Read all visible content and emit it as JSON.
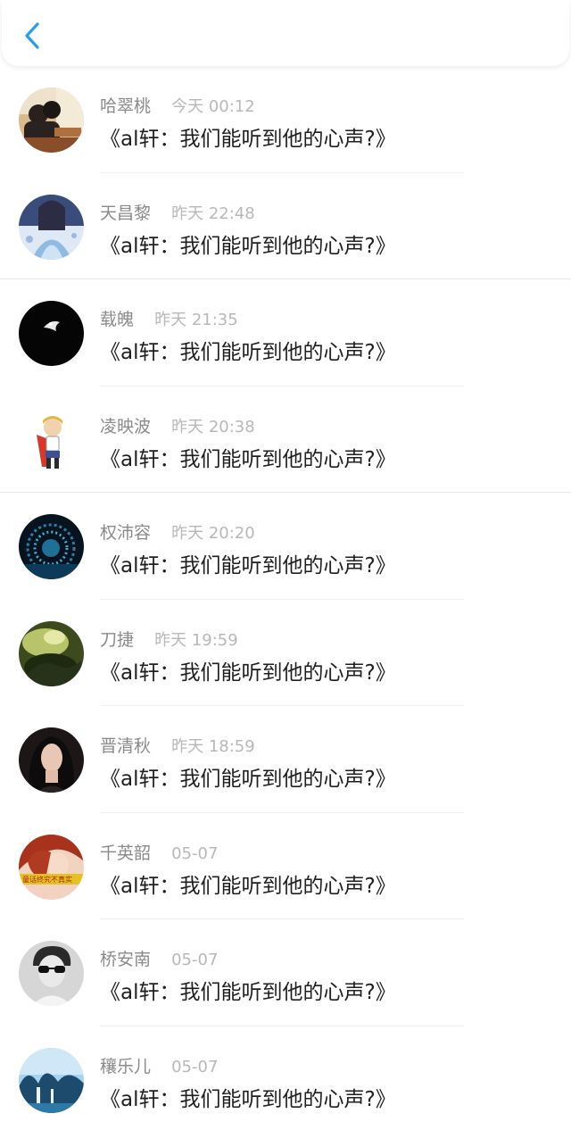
{
  "header": {
    "back_icon": "chevron-left-icon",
    "accent": "#2f9be3"
  },
  "messages": [
    {
      "name": "哈翠桃",
      "time": "今天 00:12",
      "text": "《al轩：我们能听到他的心声?》"
    },
    {
      "name": "天昌黎",
      "time": "昨天 22:48",
      "text": "《al轩：我们能听到他的心声?》"
    },
    {
      "name": "载魄",
      "time": "昨天 21:35",
      "text": "《al轩：我们能听到他的心声?》"
    },
    {
      "name": "凌映波",
      "time": "昨天 20:38",
      "text": "《al轩：我们能听到他的心声?》"
    },
    {
      "name": "权沛容",
      "time": "昨天 20:20",
      "text": "《al轩：我们能听到他的心声?》"
    },
    {
      "name": "刀捷",
      "time": "昨天 19:59",
      "text": "《al轩：我们能听到他的心声?》"
    },
    {
      "name": "晋清秋",
      "time": "昨天 18:59",
      "text": "《al轩：我们能听到他的心声?》"
    },
    {
      "name": "千英韶",
      "time": "05-07",
      "text": "《al轩：我们能听到他的心声?》",
      "avatar_caption": "童话终究不真实"
    },
    {
      "name": "桥安南",
      "time": "05-07",
      "text": "《al轩：我们能听到他的心声?》"
    },
    {
      "name": "穰乐儿",
      "time": "05-07",
      "text": "《al轩：我们能听到他的心声?》"
    }
  ]
}
